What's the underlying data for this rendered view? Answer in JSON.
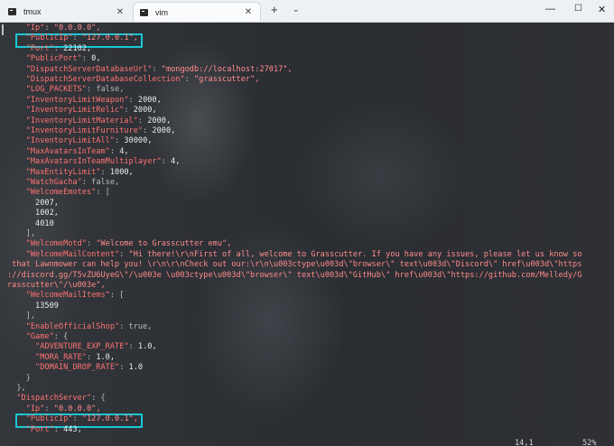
{
  "window": {
    "tabs": [
      {
        "label": "tmux",
        "close": "✕",
        "active": false
      },
      {
        "label": "vim",
        "close": "✕",
        "active": true
      }
    ],
    "new_tab": "+",
    "dropdown": "⌄",
    "controls": {
      "minimize": "—",
      "maximize": "☐",
      "close": "✕"
    }
  },
  "editor": {
    "lines": [
      "    \"Ip\": \"0.0.0.0\",",
      "    \"PublicIp\": \"127.0.0.1\",",
      "    \"Port\": 22102,",
      "    \"PublicPort\": 0,",
      "    \"DispatchServerDatabaseUrl\": \"mongodb://localhost:27017\",",
      "    \"DispatchServerDatabaseCollection\": \"grasscutter\",",
      "    \"LOG_PACKETS\": false,",
      "    \"InventoryLimitWeapon\": 2000,",
      "    \"InventoryLimitRelic\": 2000,",
      "    \"InventoryLimitMaterial\": 2000,",
      "    \"InventoryLimitFurniture\": 2000,",
      "    \"InventoryLimitAll\": 30000,",
      "    \"MaxAvatarsInTeam\": 4,",
      "    \"MaxAvatarsInTeamMultiplayer\": 4,",
      "    \"MaxEntityLimit\": 1000,",
      "    \"WatchGacha\": false,",
      "    \"WelcomeEmotes\": [",
      "      2007,",
      "      1002,",
      "      4010",
      "    ],",
      "    \"WelcomeMotd\": \"Welcome to Grasscutter emu\",",
      "    \"WelcomeMailContent\": \"Hi there!\\r\\nFirst of all, welcome to Grasscutter. If you have any issues, please let us know so",
      " that Lawnmower can help you! \\r\\n\\r\\nCheck out our:\\r\\n\\u003ctype\\u003d\\\"browser\\\" text\\u003d\\\"Discord\\\" href\\u003d\\\"https",
      "://discord.gg/T5vZU6UyeG\\\"/\\u003e \\u003ctype\\u003d\\\"browser\\\" text\\u003d\\\"GitHub\\\" href\\u003d\\\"https://github.com/Melledy/G",
      "rasscutter\\\"/\\u003e\",",
      "    \"WelcomeMailItems\": [",
      "      13509",
      "    ],",
      "    \"EnableOfficialShop\": true,",
      "    \"Game\": {",
      "      \"ADVENTURE_EXP_RATE\": 1.0,",
      "      \"MORA_RATE\": 1.0,",
      "      \"DOMAIN_DROP_RATE\": 1.0",
      "    }",
      "  },",
      "  \"DispatchServer\": {",
      "    \"Ip\": \"0.0.0.0\",",
      "    \"PublicIp\": \"127.0.0.1\",",
      "    \"Port\": 443,"
    ],
    "status": {
      "position": "14,1",
      "scroll": "52%"
    }
  },
  "colors": {
    "key": "#ff7373",
    "highlight_box": "#19c7d6",
    "background": "#2b2e33"
  }
}
